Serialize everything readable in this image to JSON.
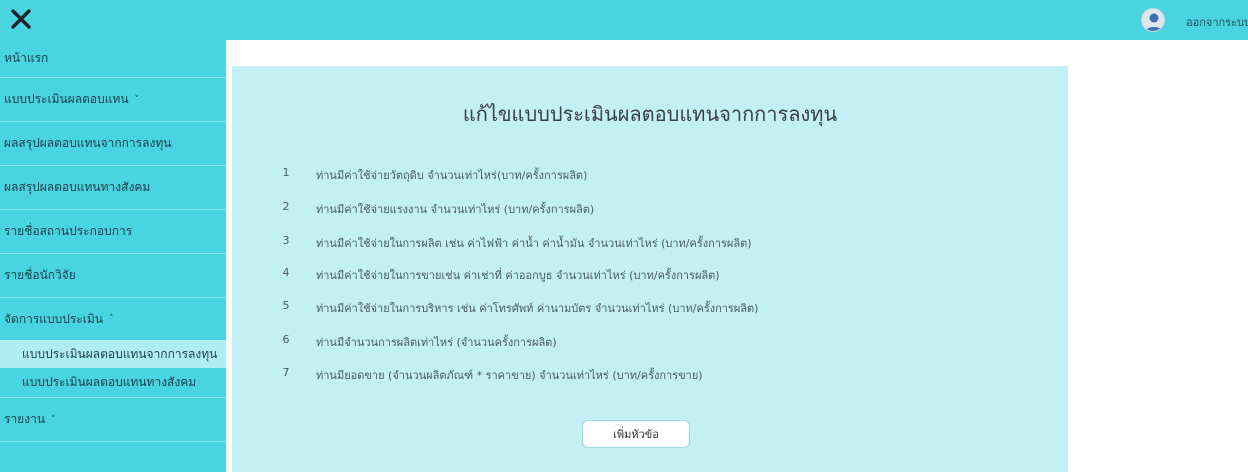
{
  "header": {
    "logout_label": "ออกจากระบบ"
  },
  "sidebar": {
    "items": [
      {
        "label": "หน้าแรก"
      },
      {
        "label": "แบบประเมินผลตอบแทน",
        "chevron": "˅"
      },
      {
        "label": "ผลสรุปผลตอบแทนจากการลงทุน"
      },
      {
        "label": "ผลสรุปผลตอบแทนทางสังคม"
      },
      {
        "label": "รายชื่อสถานประกอบการ"
      },
      {
        "label": "รายชื่อนักวิจัย"
      },
      {
        "label": "จัดการแบบประเมิน",
        "chevron": "˄"
      },
      {
        "label": "แบบประเมินผลตอบแทนจากการลงทุน"
      },
      {
        "label": "แบบประเมินผลตอบแทนทางสังคม"
      },
      {
        "label": "รายงาน",
        "chevron": "˅"
      }
    ]
  },
  "main": {
    "title": "แก้ไขแบบประเมินผลตอบแทนจากการลงทุน",
    "questions": [
      {
        "num": "1",
        "text": "ท่านมีค่าใช้จ่ายวัตถุดิบ จำนวนเท่าไหร่(บาท/ครั้งการผลิต)"
      },
      {
        "num": "2",
        "text": "ท่านมีค่าใช้จ่ายแรงงาน จำนวนเท่าไหร่ (บาท/ครั้งการผลิต)"
      },
      {
        "num": "3",
        "text": "ท่านมีค่าใช้จ่ายในการผลิต เช่น ค่าไฟฟ้า ค่าน้ำ ค่าน้ำมัน จำนวนเท่าไหร่ (บาท/ครั้งการผลิต)"
      },
      {
        "num": "4",
        "text": "ท่านมีค่าใช้จ่ายในการขายเช่น ค่าเช่าที่ ค่าออกบูธ จำนวนเท่าไหร่ (บาท/ครั้งการผลิต)"
      },
      {
        "num": "5",
        "text": "ท่านมีค่าใช้จ่ายในการบริหาร เช่น ค่าโทรศัพท์ ค่านามบัตร จำนวนเท่าไหร่ (บาท/ครั้งการผลิต)"
      },
      {
        "num": "6",
        "text": "ท่านมีจำนวนการผลิตเท่าไหร่ (จำนวนครั้งการผลิต)"
      },
      {
        "num": "7",
        "text": "ท่านมียอดขาย (จำนวนผลิตภัณฑ์ * ราคาขาย) จำนวนเท่าไหร่ (บาท/ครั้งการขาย)"
      }
    ],
    "add_button_label": "เพิ่มหัวข้อ"
  },
  "colors": {
    "topbar": "#48d4e0",
    "sidebar": "#48d4e0",
    "sidebar_active": "#aeeef3",
    "card": "#c3f0f4"
  },
  "icons": {
    "close": "close-icon",
    "avatar": "user-avatar-icon"
  }
}
